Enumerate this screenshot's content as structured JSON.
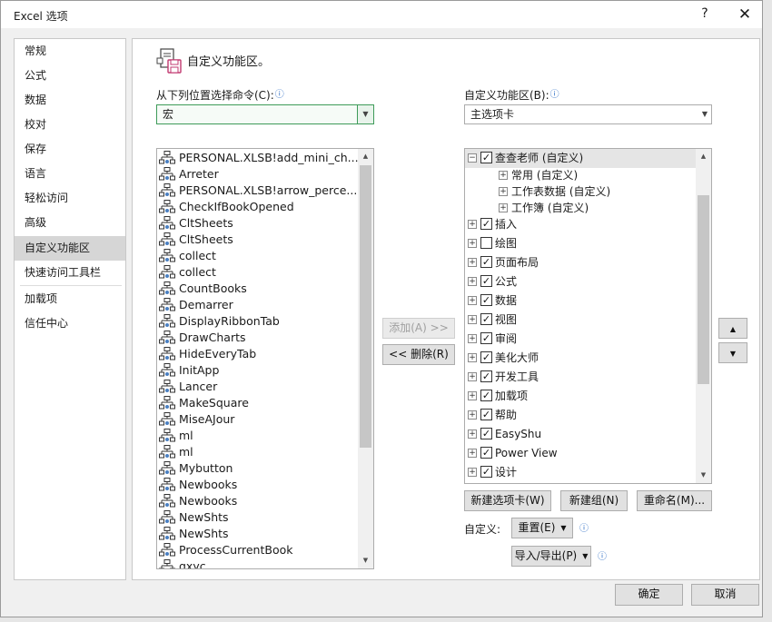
{
  "window": {
    "title": "Excel 选项",
    "help": "?",
    "close": "✕"
  },
  "nav": {
    "items": [
      {
        "label": "常规"
      },
      {
        "label": "公式"
      },
      {
        "label": "数据"
      },
      {
        "label": "校对"
      },
      {
        "label": "保存"
      },
      {
        "label": "语言"
      },
      {
        "label": "轻松访问"
      },
      {
        "label": "高级"
      },
      {
        "label": "自定义功能区"
      },
      {
        "label": "快速访问工具栏"
      },
      {
        "label": "加载项"
      },
      {
        "label": "信任中心"
      }
    ],
    "selected": "自定义功能区"
  },
  "section": {
    "title": "自定义功能区。",
    "icon": "customize-ribbon-icon"
  },
  "left": {
    "label": "从下列位置选择命令(C):",
    "combo_value": "宏",
    "commands": [
      "PERSONAL.XLSB!add_mini_ch...",
      "Arreter",
      "PERSONAL.XLSB!arrow_perce...",
      "CheckIfBookOpened",
      "CltSheets",
      "CltSheets",
      "collect",
      "collect",
      "CountBooks",
      "Demarrer",
      "DisplayRibbonTab",
      "DrawCharts",
      "HideEveryTab",
      "InitApp",
      "Lancer",
      "MakeSquare",
      "MiseAJour",
      "ml",
      "ml",
      "Mybutton",
      "Newbooks",
      "Newbooks",
      "NewShts",
      "NewShts",
      "ProcessCurrentBook",
      "qxyc"
    ],
    "command_icon": "macro-icon"
  },
  "middle": {
    "add_label": "添加(A) >>",
    "remove_label": "<< 删除(R)"
  },
  "right": {
    "label": "自定义功能区(B):",
    "combo_value": "主选项卡",
    "tree": [
      {
        "label": "查查老师 (自定义)",
        "level": 0,
        "expanded": true,
        "checked": true,
        "selected": true
      },
      {
        "label": "常用 (自定义)",
        "level": 1,
        "expanded": false,
        "checked": null
      },
      {
        "label": "工作表数据 (自定义)",
        "level": 1,
        "expanded": false,
        "checked": null
      },
      {
        "label": "工作簿 (自定义)",
        "level": 1,
        "expanded": false,
        "checked": null
      },
      {
        "label": "插入",
        "level": 0,
        "expanded": false,
        "checked": true
      },
      {
        "label": "绘图",
        "level": 0,
        "expanded": false,
        "checked": false
      },
      {
        "label": "页面布局",
        "level": 0,
        "expanded": false,
        "checked": true
      },
      {
        "label": "公式",
        "level": 0,
        "expanded": false,
        "checked": true
      },
      {
        "label": "数据",
        "level": 0,
        "expanded": false,
        "checked": true
      },
      {
        "label": "视图",
        "level": 0,
        "expanded": false,
        "checked": true
      },
      {
        "label": "审阅",
        "level": 0,
        "expanded": false,
        "checked": true
      },
      {
        "label": "美化大师",
        "level": 0,
        "expanded": false,
        "checked": true
      },
      {
        "label": "开发工具",
        "level": 0,
        "expanded": false,
        "checked": true
      },
      {
        "label": "加载项",
        "level": 0,
        "expanded": false,
        "checked": true
      },
      {
        "label": "帮助",
        "level": 0,
        "expanded": false,
        "checked": true
      },
      {
        "label": "EasyShu",
        "level": 0,
        "expanded": false,
        "checked": true
      },
      {
        "label": "Power View",
        "level": 0,
        "expanded": false,
        "checked": true
      },
      {
        "label": "设计",
        "level": 0,
        "expanded": false,
        "checked": true
      }
    ],
    "new_tab_label": "新建选项卡(W)",
    "new_group_label": "新建组(N)",
    "rename_label": "重命名(M)...",
    "customize_label": "自定义:",
    "reset_label": "重置(E)",
    "import_export_label": "导入/导出(P)",
    "move_up": "▲",
    "move_down": "▼"
  },
  "footer": {
    "ok_label": "确定",
    "cancel_label": "取消"
  }
}
